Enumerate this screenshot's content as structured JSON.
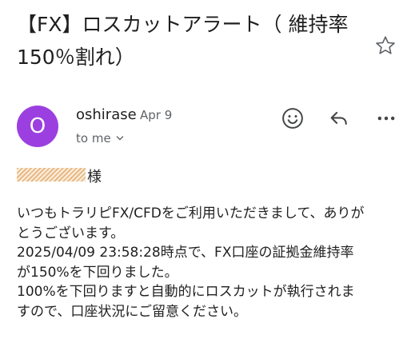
{
  "email": {
    "subject_line1": "【FX】ロスカットアラート（ 維持率",
    "subject_line2": "150％割れ）",
    "sender": "oshirase",
    "sender_initial": "O",
    "date": "Apr 9",
    "recipient": "to me",
    "salutation": "様",
    "body_lines": [
      "いつもトラリピFX/CFDをご利用いただきまして、ありが",
      "とうございます。",
      "2025/04/09 23:58:28時点で、FX口座の証拠金維持率",
      "が150%を下回りました。",
      "100%を下回りますと自動的にロスカットが執行されま",
      "すので、口座状況にご留意ください。"
    ]
  },
  "icons": {
    "star": "star-outline-icon",
    "emoji": "add-reaction-icon",
    "reply": "reply-icon",
    "more": "more-horizontal-icon",
    "chevron": "chevron-down-icon"
  },
  "colors": {
    "avatar_bg": "#9c3fe0",
    "text": "#1f1f1f",
    "secondary_text": "#5f6368",
    "icon": "#444746",
    "redaction": "#e8b985"
  }
}
